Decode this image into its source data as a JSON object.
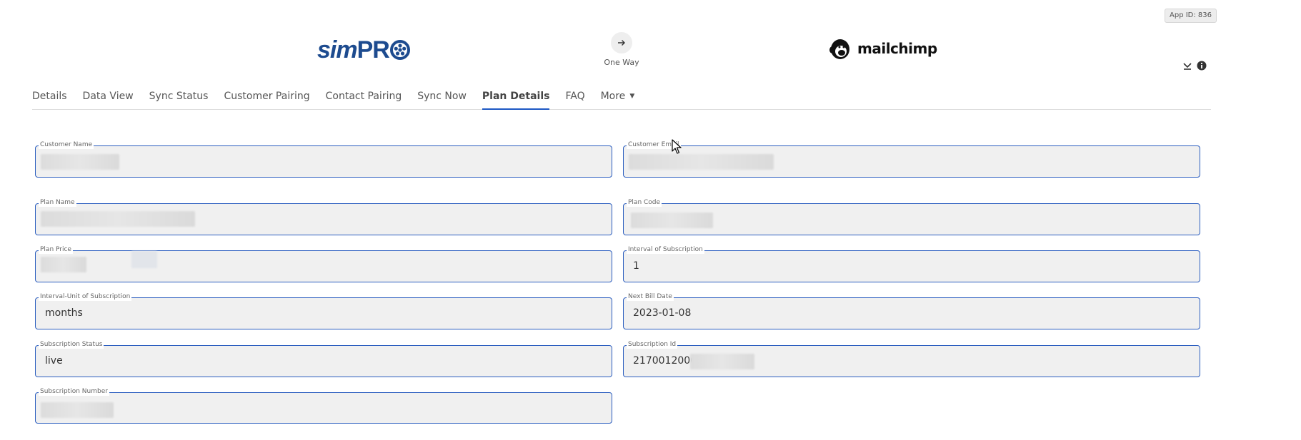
{
  "header": {
    "app_id": "App ID: 836",
    "left_logo": {
      "name": "simpro-logo",
      "part1": "sim",
      "part2": "PR"
    },
    "right_logo": {
      "name": "mailchimp-logo",
      "text": "mailchimp"
    },
    "sync_direction": {
      "icon": "arrow-right-icon",
      "label": "One Way"
    },
    "icons": [
      "download-icon",
      "info-icon"
    ]
  },
  "tabs": [
    {
      "label": "Details"
    },
    {
      "label": "Data View"
    },
    {
      "label": "Sync Status"
    },
    {
      "label": "Customer Pairing"
    },
    {
      "label": "Contact Pairing"
    },
    {
      "label": "Sync Now"
    },
    {
      "label": "Plan Details",
      "active": true
    },
    {
      "label": "FAQ"
    },
    {
      "label": "More"
    }
  ],
  "fields": {
    "customer_name": {
      "label": "Customer Name",
      "value": ""
    },
    "customer_email": {
      "label": "Customer Email",
      "value": ""
    },
    "plan_name": {
      "label": "Plan Name",
      "value": ""
    },
    "plan_code": {
      "label": "Plan Code",
      "value": ""
    },
    "plan_price": {
      "label": "Plan Price",
      "value": ""
    },
    "interval": {
      "label": "Interval of Subscription",
      "value": "1"
    },
    "interval_unit": {
      "label": "Interval-Unit of Subscription",
      "value": "months"
    },
    "next_bill_date": {
      "label": "Next Bill Date",
      "value": "2023-01-08"
    },
    "subscription_status": {
      "label": "Subscription Status",
      "value": "live"
    },
    "subscription_id": {
      "label": "Subscription Id",
      "value": "21700120000"
    },
    "subscription_number": {
      "label": "Subscription Number",
      "value": ""
    }
  },
  "colors": {
    "accent": "#2a5dbf",
    "brand_simpro": "#1d4b8f",
    "field_bg": "#f0f0f0"
  }
}
